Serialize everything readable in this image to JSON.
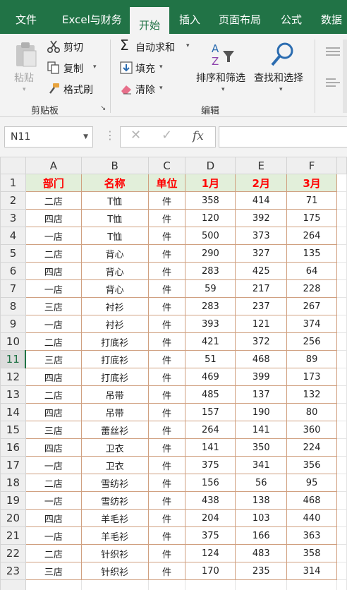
{
  "ribbon_tabs": [
    "文件",
    "Excel与财务",
    "开始",
    "插入",
    "页面布局",
    "公式",
    "数据"
  ],
  "active_tab": "开始",
  "clipboard": {
    "paste": "粘贴",
    "cut": "剪切",
    "copy": "复制",
    "format_painter": "格式刷",
    "group_label": "剪贴板"
  },
  "editing": {
    "autosum": "自动求和",
    "fill": "填充",
    "clear": "清除",
    "sort_filter": "排序和筛选",
    "find_select": "查找和选择",
    "group_label": "编辑"
  },
  "formula_bar": {
    "name_box": "N11",
    "fx_symbol": "fx",
    "formula": ""
  },
  "columns": [
    "A",
    "B",
    "C",
    "D",
    "E",
    "F"
  ],
  "selected_row": 11,
  "table": {
    "headers": [
      "部门",
      "名称",
      "单位",
      "1月",
      "2月",
      "3月"
    ],
    "rows": [
      [
        "二店",
        "T恤",
        "件",
        "358",
        "414",
        "71"
      ],
      [
        "四店",
        "T恤",
        "件",
        "120",
        "392",
        "175"
      ],
      [
        "一店",
        "T恤",
        "件",
        "500",
        "373",
        "264"
      ],
      [
        "二店",
        "背心",
        "件",
        "290",
        "327",
        "135"
      ],
      [
        "四店",
        "背心",
        "件",
        "283",
        "425",
        "64"
      ],
      [
        "一店",
        "背心",
        "件",
        "59",
        "217",
        "228"
      ],
      [
        "三店",
        "衬衫",
        "件",
        "283",
        "237",
        "267"
      ],
      [
        "一店",
        "衬衫",
        "件",
        "393",
        "121",
        "374"
      ],
      [
        "二店",
        "打底衫",
        "件",
        "421",
        "372",
        "256"
      ],
      [
        "三店",
        "打底衫",
        "件",
        "51",
        "468",
        "89"
      ],
      [
        "四店",
        "打底衫",
        "件",
        "469",
        "399",
        "173"
      ],
      [
        "二店",
        "吊带",
        "件",
        "485",
        "137",
        "132"
      ],
      [
        "四店",
        "吊带",
        "件",
        "157",
        "190",
        "80"
      ],
      [
        "三店",
        "蕾丝衫",
        "件",
        "264",
        "141",
        "360"
      ],
      [
        "四店",
        "卫衣",
        "件",
        "141",
        "350",
        "224"
      ],
      [
        "一店",
        "卫衣",
        "件",
        "375",
        "341",
        "356"
      ],
      [
        "二店",
        "雪纺衫",
        "件",
        "156",
        "56",
        "95"
      ],
      [
        "一店",
        "雪纺衫",
        "件",
        "438",
        "138",
        "468"
      ],
      [
        "四店",
        "羊毛衫",
        "件",
        "204",
        "103",
        "440"
      ],
      [
        "一店",
        "羊毛衫",
        "件",
        "375",
        "166",
        "363"
      ],
      [
        "二店",
        "针织衫",
        "件",
        "124",
        "483",
        "358"
      ],
      [
        "三店",
        "针织衫",
        "件",
        "170",
        "235",
        "314"
      ]
    ]
  },
  "colors": {
    "excel_green": "#217346",
    "header_fill": "#e2efda",
    "header_text": "#ff0000",
    "cell_border": "#d0a080"
  }
}
